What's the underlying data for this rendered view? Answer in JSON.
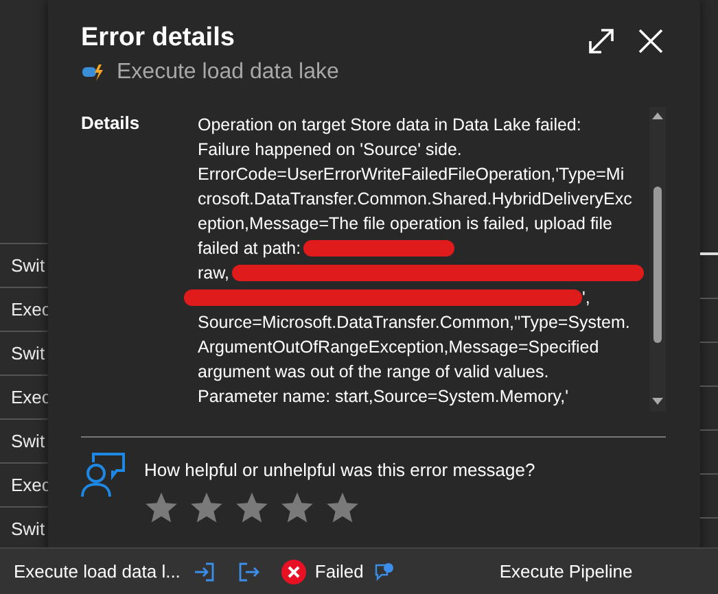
{
  "background_rows": [
    {
      "label": "Swit"
    },
    {
      "label": "Exec"
    },
    {
      "label": "Swit"
    },
    {
      "label": "Exec"
    },
    {
      "label": "Swit"
    },
    {
      "label": "Exec"
    },
    {
      "label": "Swit"
    }
  ],
  "dialog": {
    "title": "Error details",
    "subtitle": "Execute load data lake",
    "details_label": "Details",
    "message_lines": [
      {
        "text": "Operation on target Store data in Data Lake failed:",
        "kind": "plain"
      },
      {
        "text": "Failure happened on 'Source' side.",
        "kind": "plain"
      },
      {
        "text": "ErrorCode=UserErrorWriteFailedFileOperation,'Type=Mi",
        "kind": "plain"
      },
      {
        "text": "crosoft.DataTransfer.Common.Shared.HybridDeliveryExc",
        "kind": "plain"
      },
      {
        "text": "eption,Message=The file operation is failed, upload file",
        "kind": "plain"
      },
      {
        "text": "failed at path:",
        "kind": "redactedafter"
      },
      {
        "text": "raw,",
        "kind": "redactedafter"
      },
      {
        "text": "',",
        "kind": "redactedbefore"
      },
      {
        "text": "Source=Microsoft.DataTransfer.Common,''Type=System.",
        "kind": "plain"
      },
      {
        "text": "ArgumentOutOfRangeException,Message=Specified",
        "kind": "plain"
      },
      {
        "text": "argument was out of the range of valid values.",
        "kind": "plain"
      },
      {
        "text": "Parameter name: start,Source=System.Memory,'",
        "kind": "plain"
      }
    ],
    "feedback": {
      "question": "How helpful or unhelpful was this error message?",
      "stars": 0
    }
  },
  "activity_row": {
    "name": "Execute load data l...",
    "status": "Failed",
    "type": "Execute Pipeline"
  }
}
